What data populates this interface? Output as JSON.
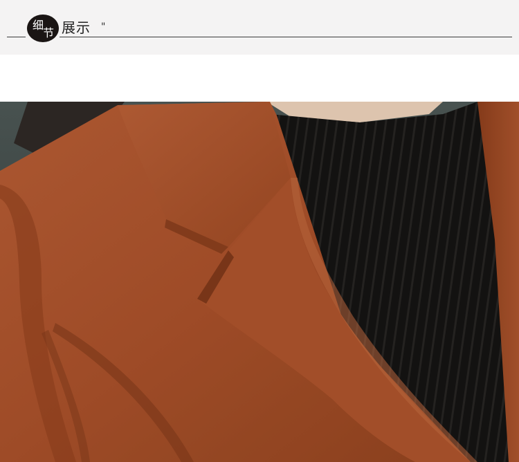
{
  "header": {
    "badge_char_1": "细",
    "badge_char_2": "节",
    "title": "展示",
    "title_mark": "\""
  },
  "photo": {
    "subject": "product-detail-photo",
    "colors": {
      "coat": "#a5502b",
      "coat_shadow": "#7a3618",
      "sweater": "#151413",
      "skin": "#ead3bd",
      "background": "#3e4a48"
    }
  }
}
